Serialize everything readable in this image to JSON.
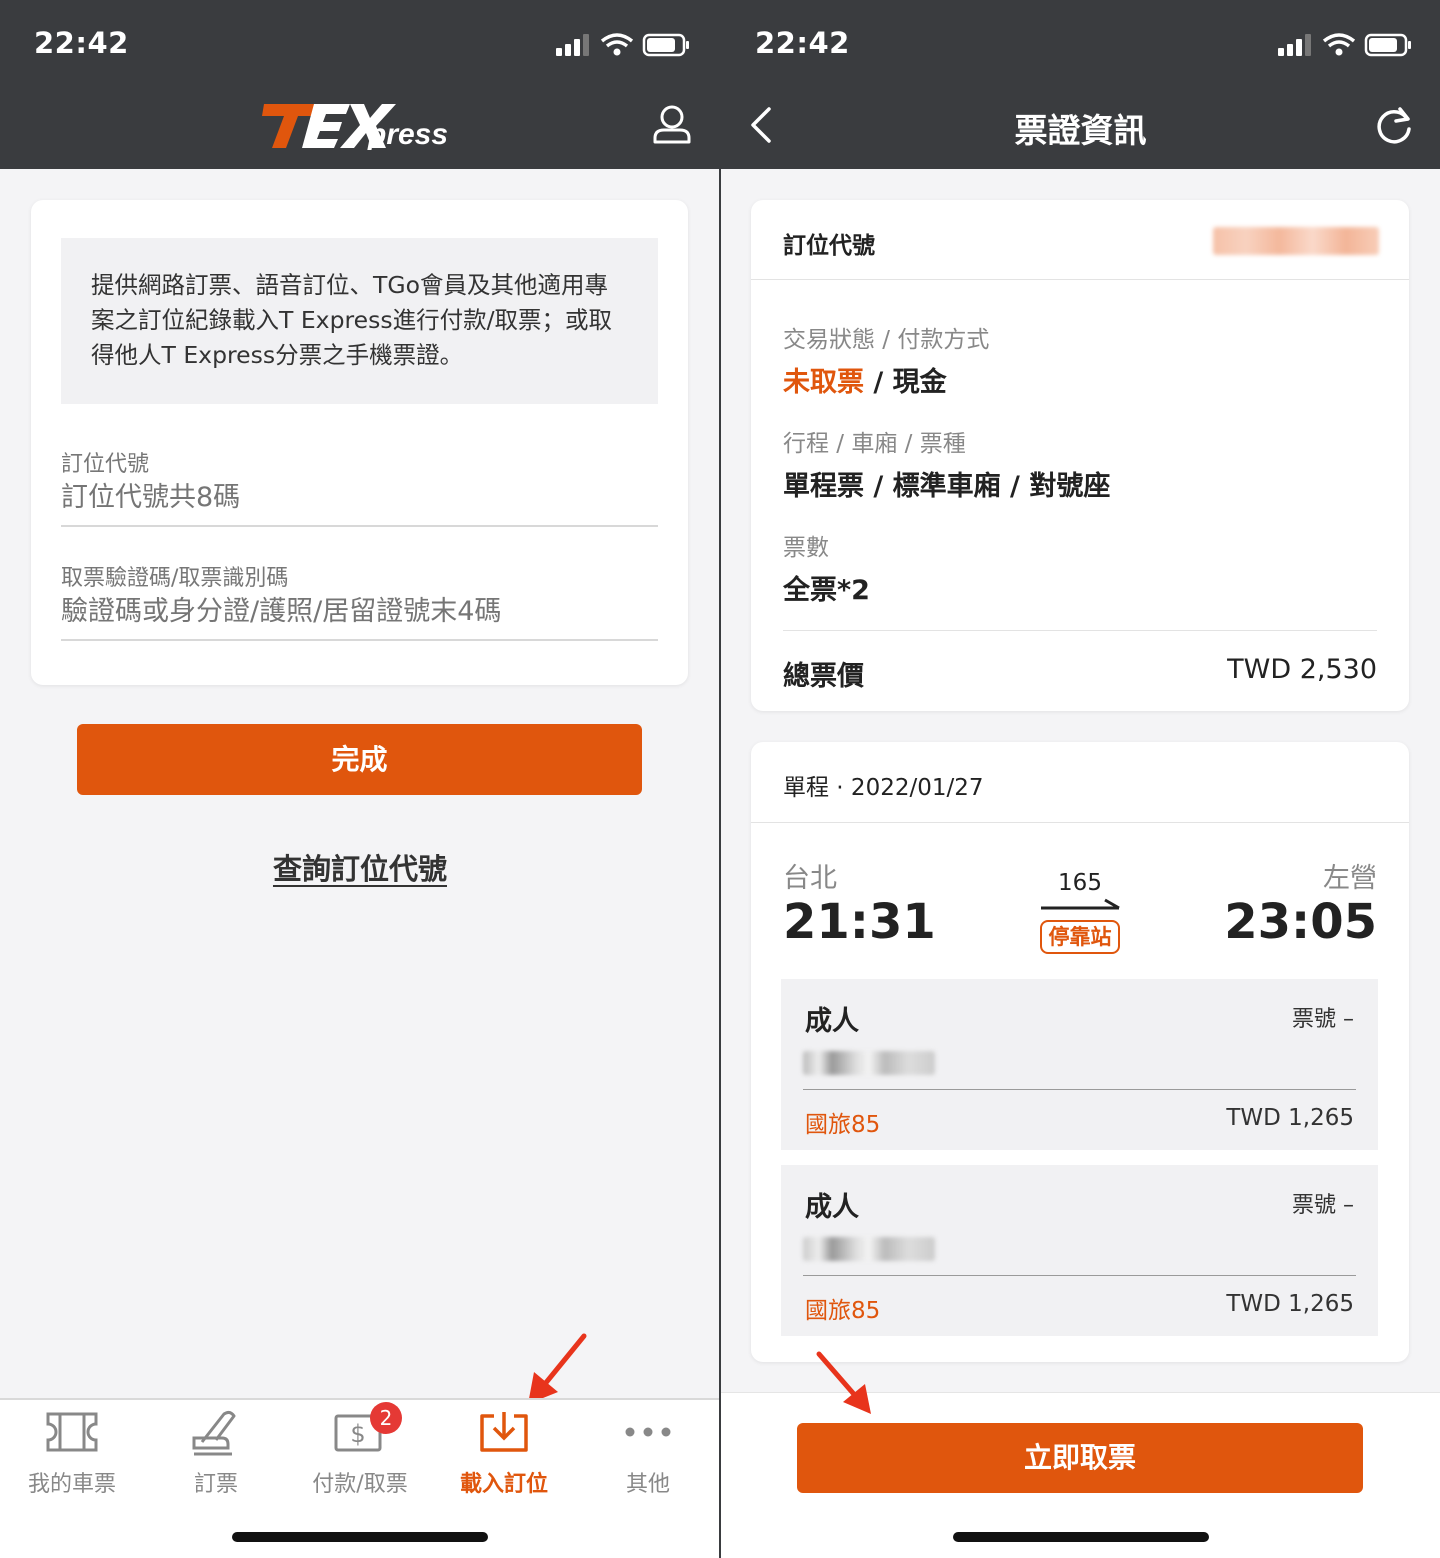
{
  "left": {
    "status_time": "22:42",
    "info_text": "提供網路訂票、語音訂位、TGo會員及其他適用專案之訂位紀錄載入T Express進行付款/取票；或取得他人T Express分票之手機票證。",
    "booking_label": "訂位代號",
    "booking_placeholder": "訂位代號共8碼",
    "verify_label": "取票驗證碼/取票識別碼",
    "verify_placeholder": "驗證碼或身分證/護照/居留證號末4碼",
    "submit_label": "完成",
    "lookup_link": "查詢訂位代號",
    "tabs": [
      {
        "label": "我的車票",
        "icon": "ticket-icon"
      },
      {
        "label": "訂票",
        "icon": "seat-icon"
      },
      {
        "label": "付款/取票",
        "icon": "payment-icon",
        "badge": "2"
      },
      {
        "label": "載入訂位",
        "icon": "download-icon"
      },
      {
        "label": "其他",
        "icon": "more-icon"
      }
    ],
    "accent_color": "#e0560d"
  },
  "right": {
    "status_time": "22:42",
    "title": "票證資訊",
    "booking_code_label": "訂位代號",
    "status_label": "交易狀態 / 付款方式",
    "status_value": "未取票",
    "payment_value": "現金",
    "trip_label": "行程 / 車廂 / 票種",
    "trip_value": "單程票 / 標準車廂 / 對號座",
    "count_label": "票數",
    "count_value": "全票*2",
    "total_label": "總票價",
    "total_value": "TWD 2,530",
    "journey_header": "單程 · 2022/01/27",
    "from_station": "台北",
    "from_time": "21:31",
    "to_station": "左營",
    "to_time": "23:05",
    "train_no": "165",
    "stop_tag": "停靠站",
    "passengers": [
      {
        "type": "成人",
        "ticket": "票號 –",
        "discount": "國旅85",
        "price": "TWD 1,265"
      },
      {
        "type": "成人",
        "ticket": "票號 –",
        "discount": "國旅85",
        "price": "TWD 1,265"
      }
    ],
    "pickup_button": "立即取票"
  }
}
